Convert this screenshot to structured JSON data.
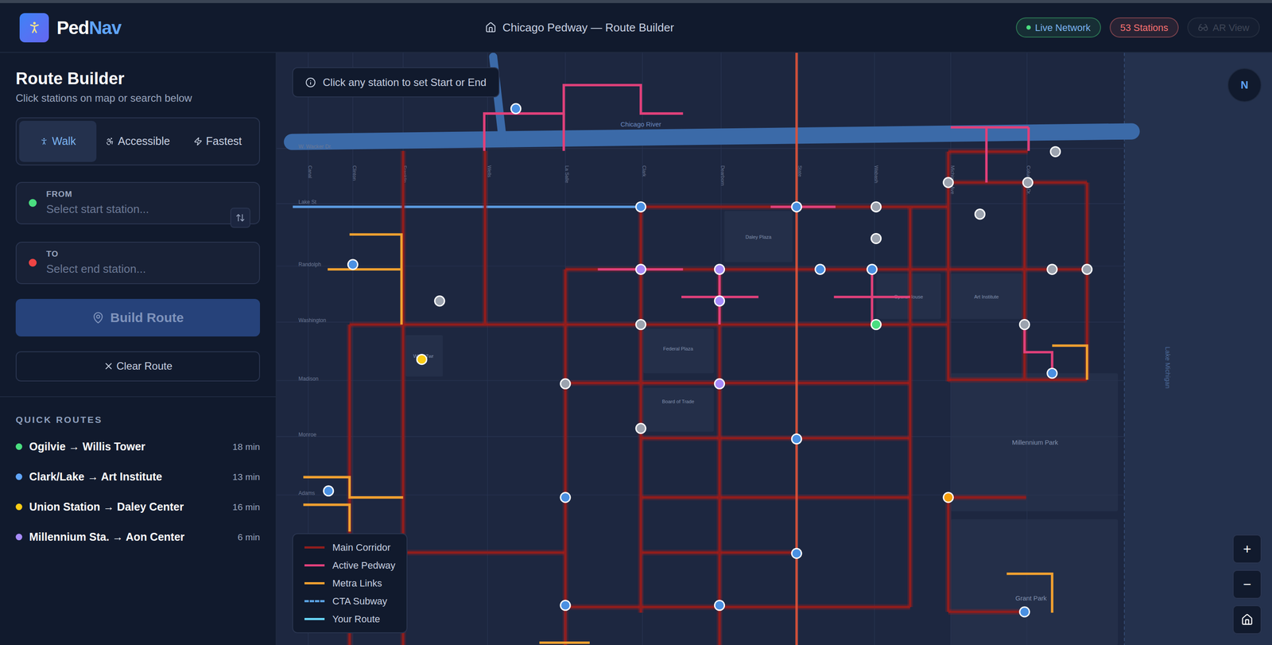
{
  "header": {
    "brand_primary": "Ped",
    "brand_accent": "Nav",
    "title": "Chicago Pedway — Route Builder",
    "badges": [
      {
        "label": "Live Network",
        "color": "#4ade80",
        "dot": true,
        "disabled": false
      },
      {
        "label": "53 Stations",
        "color": "#f87171",
        "dot": false,
        "disabled": false
      },
      {
        "label": "AR View",
        "color": "#6b7280",
        "dot": false,
        "disabled": true
      }
    ]
  },
  "sidebar": {
    "title": "Route Builder",
    "subtitle": "Click stations on map or search below",
    "modes": [
      {
        "label": "Walk",
        "kind": "walk",
        "selected": true
      },
      {
        "label": "Accessible",
        "kind": "accessible",
        "selected": false
      },
      {
        "label": "Fastest",
        "kind": "fastest",
        "selected": false
      }
    ],
    "from": {
      "label": "FROM",
      "placeholder": "Select start station...",
      "color": "#4ade80"
    },
    "to": {
      "label": "TO",
      "placeholder": "Select end station...",
      "color": "#ef4444"
    },
    "build_button": {
      "label": "Build Route",
      "disabled": true
    },
    "clear_button": {
      "label": "Clear Route"
    },
    "quick_routes_title": "QUICK ROUTES",
    "quick_routes": [
      {
        "label": "Ogilvie → Willis Tower",
        "time": "18 min",
        "color": "#4ade80"
      },
      {
        "label": "Clark/Lake → Art Institute",
        "time": "13 min",
        "color": "#60a5fa"
      },
      {
        "label": "Union Station → Daley Center",
        "time": "16 min",
        "color": "#facc15"
      },
      {
        "label": "Millennium Sta. → Aon Center",
        "time": "6 min",
        "color": "#a78bfa"
      }
    ]
  },
  "map": {
    "hint": "Click any station to set Start or End",
    "compass": "N",
    "zoom_in": "+",
    "zoom_out": "−",
    "river_label": "Chicago River",
    "water_label": "Lake Michigan",
    "streets_vertical": [
      "Canal",
      "Clinton",
      "Franklin",
      "Wells",
      "La Salle",
      "Clark",
      "Dearborn",
      "State",
      "Wabash",
      "Michigan Ave",
      "Columbus Dr."
    ],
    "streets_horizontal": [
      "W. Wacker Dr.",
      "Lake St",
      "Randolph",
      "Washington",
      "Madison",
      "Monroe",
      "Adams"
    ],
    "places": [
      "Daley Plaza",
      "Federal Plaza",
      "Board of Trade",
      "Opera House",
      "Art Institute",
      "Willis Twr",
      "Millennium Park",
      "Grant Park"
    ],
    "legend": [
      {
        "label": "Main Corridor",
        "color": "#8f1d1d",
        "kind": "solid"
      },
      {
        "label": "Active Pedway",
        "color": "#e0407a",
        "kind": "solid"
      },
      {
        "label": "Metra Links",
        "color": "#f0a030",
        "kind": "solid"
      },
      {
        "label": "CTA Subway",
        "color": "#5aa0e0",
        "kind": "dashed"
      },
      {
        "label": "Your Route",
        "color": "#67d4f5",
        "kind": "solid"
      }
    ],
    "stations": [
      {
        "color": "#4a90e2"
      },
      {
        "color": "#9ca3af"
      },
      {
        "color": "#9ca3af"
      },
      {
        "color": "#9ca3af"
      },
      {
        "color": "#4a90e2"
      },
      {
        "color": "#4a90e2"
      },
      {
        "color": "#9ca3af"
      },
      {
        "color": "#9ca3af"
      },
      {
        "color": "#9ca3af"
      },
      {
        "color": "#4a90e2"
      },
      {
        "color": "#a78bfa"
      },
      {
        "color": "#a78bfa"
      },
      {
        "color": "#4a90e2"
      },
      {
        "color": "#4a90e2"
      },
      {
        "color": "#9ca3af"
      },
      {
        "color": "#9ca3af"
      },
      {
        "color": "#9ca3af"
      },
      {
        "color": "#a78bfa"
      },
      {
        "color": "#9ca3af"
      },
      {
        "color": "#4ade80"
      },
      {
        "color": "#9ca3af"
      },
      {
        "color": "#4a90e2"
      },
      {
        "color": "#facc15"
      },
      {
        "color": "#9ca3af"
      },
      {
        "color": "#a78bfa"
      },
      {
        "color": "#9ca3af"
      },
      {
        "color": "#4a90e2"
      },
      {
        "color": "#4a90e2"
      },
      {
        "color": "#4a90e2"
      },
      {
        "color": "#f59e0b"
      },
      {
        "color": "#4a90e2"
      },
      {
        "color": "#4a90e2"
      },
      {
        "color": "#4a90e2"
      },
      {
        "color": "#4a90e2"
      }
    ]
  }
}
